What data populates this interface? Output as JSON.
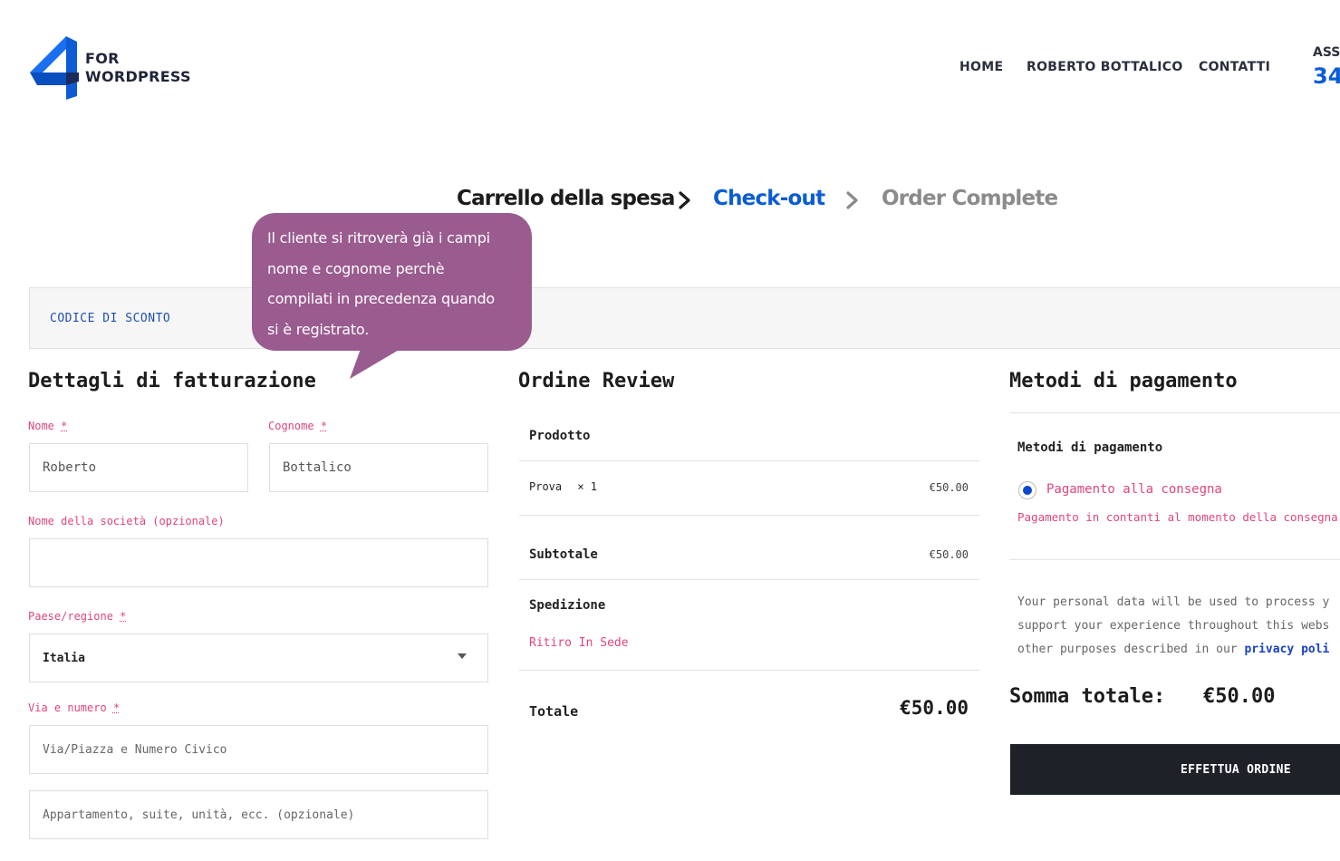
{
  "header": {
    "logo_line1": "FOR",
    "logo_line2": "WORDPRESS",
    "nav": [
      "HOME",
      "ROBERTO BOTTALICO",
      "CONTATTI"
    ],
    "assist_label": "ASSI",
    "assist_phone": "34"
  },
  "steps": {
    "cart": "Carrello della spesa",
    "checkout": "Check-out",
    "complete": "Order Complete"
  },
  "coupon": {
    "label": "CODICE DI SCONTO"
  },
  "tooltip": {
    "lines": [
      "Il cliente si ritroverà già i campi",
      "nome e cognome perchè",
      "compilati in precedenza quando",
      "si è registrato."
    ]
  },
  "billing": {
    "title": "Dettagli di fatturazione",
    "first_name_label": "Nome",
    "first_name_value": "Roberto",
    "last_name_label": "Cognome",
    "last_name_value": "Bottalico",
    "required_mark": "*",
    "company_label": "Nome della società (opzionale)",
    "company_value": "",
    "country_label": "Paese/regione",
    "country_value": "Italia",
    "street_label": "Via e numero",
    "street_placeholder": "Via/Piazza e Numero Civico",
    "apartment_placeholder": "Appartamento, suite, unità, ecc. (opzionale)"
  },
  "review": {
    "title": "Ordine Review",
    "product_header": "Prodotto",
    "item_name": "Prova",
    "item_qty": "× 1",
    "item_price": "€50.00",
    "subtotal_label": "Subtotale",
    "subtotal_value": "€50.00",
    "shipping_label": "Spedizione",
    "shipping_method": "Ritiro In Sede",
    "total_label": "Totale",
    "total_value": "€50.00"
  },
  "payment": {
    "title": "Metodi di pagamento",
    "subtitle": "Metodi di pagamento",
    "method_label": "Pagamento alla consegna",
    "method_desc": "Pagamento in contanti al momento della consegna",
    "privacy_line1": "Your personal data will be used to process y",
    "privacy_line2": "support your experience throughout this webs",
    "privacy_line3": "other purposes described in our ",
    "privacy_link": "privacy poli",
    "sum_label": "Somma totale:",
    "sum_value": "€50.00",
    "order_button": "EFFETTUA ORDINE"
  },
  "colors": {
    "brand_blue": "#0b5cd5",
    "accent_pink": "#e0457b",
    "tooltip_purple": "#9a5b8f",
    "button_dark": "#1e2128"
  }
}
